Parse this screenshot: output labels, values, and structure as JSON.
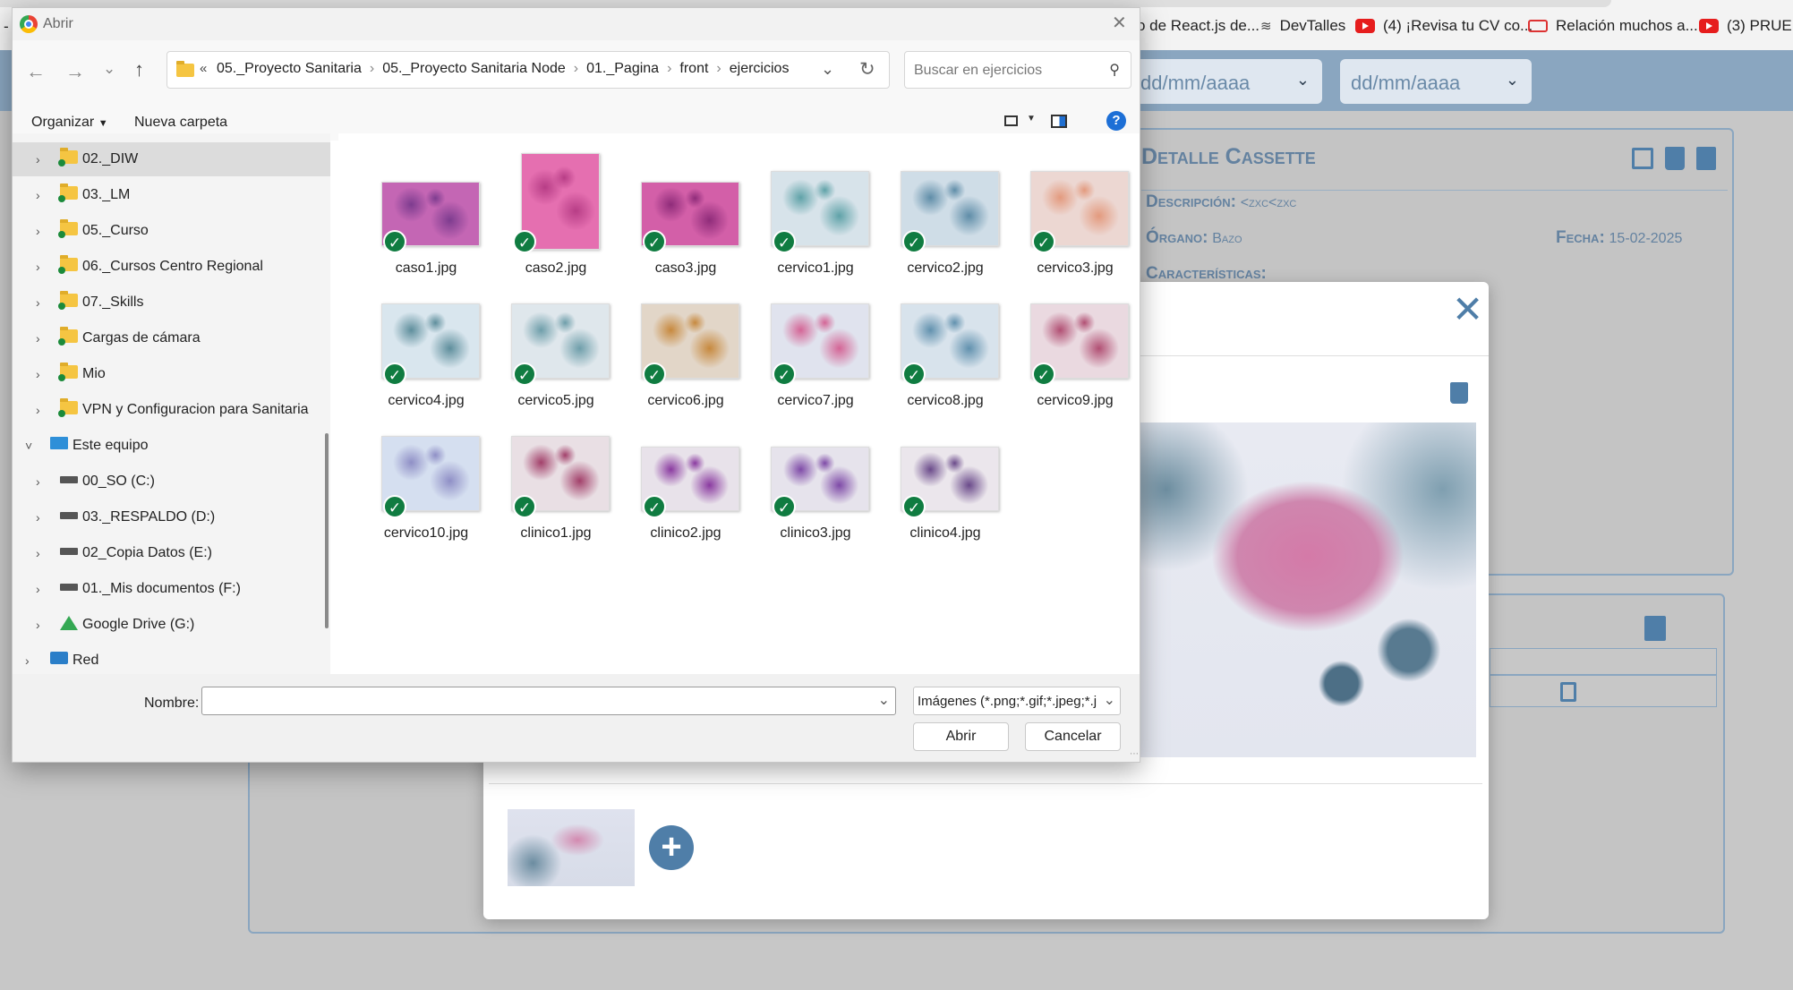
{
  "bookmarks": [
    {
      "label": "o de React.js de...",
      "icon": "react-icon"
    },
    {
      "label": "DevTalles",
      "icon": "devtalles-icon"
    },
    {
      "label": "(4) ¡Revisa tu CV co...",
      "icon": "youtube-icon"
    },
    {
      "label": "Relación muchos a...",
      "icon": "bookmark-icon"
    },
    {
      "label": "(3) PRUEBA",
      "icon": "youtube-icon"
    }
  ],
  "page": {
    "date_from_placeholder": "dd/mm/aaaa",
    "date_to_placeholder": "dd/mm/aaaa",
    "detail_title": "Detalle Cassette",
    "description_label": "Descripción:",
    "description_value": "<zxc<zxc",
    "organ_label": "Órgano:",
    "organ_value": "Bazo",
    "date_label": "Fecha:",
    "date_value": "15-02-2025",
    "features_label": "Características:"
  },
  "dialog": {
    "title": "Abrir",
    "breadcrumb": [
      "05._Proyecto Sanitaria",
      "05._Proyecto Sanitaria Node",
      "01._Pagina",
      "front",
      "ejercicios"
    ],
    "search_placeholder": "Buscar en ejercicios",
    "organize_label": "Organizar",
    "new_folder_label": "Nueva carpeta",
    "tree": [
      {
        "label": "02._DIW",
        "type": "folder",
        "indent": 1,
        "selected": true
      },
      {
        "label": "03._LM",
        "type": "folder",
        "indent": 1
      },
      {
        "label": "05._Curso",
        "type": "folder",
        "indent": 1
      },
      {
        "label": "06._Cursos Centro Regional",
        "type": "folder",
        "indent": 1
      },
      {
        "label": "07._Skills",
        "type": "folder",
        "indent": 1
      },
      {
        "label": "Cargas de cámara",
        "type": "folder",
        "indent": 1
      },
      {
        "label": "Mio",
        "type": "folder",
        "indent": 1
      },
      {
        "label": "VPN y Configuracion para Sanitaria",
        "type": "folder",
        "indent": 1
      },
      {
        "label": "Este equipo",
        "type": "pc",
        "indent": 0,
        "expanded": true
      },
      {
        "label": "00_SO (C:)",
        "type": "drive",
        "indent": 1
      },
      {
        "label": "03._RESPALDO (D:)",
        "type": "drive",
        "indent": 1
      },
      {
        "label": "02_Copia Datos (E:)",
        "type": "drive",
        "indent": 1
      },
      {
        "label": "01._Mis documentos (F:)",
        "type": "drive",
        "indent": 1
      },
      {
        "label": "Google Drive (G:)",
        "type": "gdrive",
        "indent": 1
      },
      {
        "label": "Red",
        "type": "network",
        "indent": 0
      }
    ],
    "files": [
      {
        "name": "caso1.jpg",
        "c1": "#c466b4",
        "c2": "#7d3c8f",
        "shape": "wide"
      },
      {
        "name": "caso2.jpg",
        "c1": "#e56fb0",
        "c2": "#b73d86",
        "shape": "tall"
      },
      {
        "name": "caso3.jpg",
        "c1": "#d35fa8",
        "c2": "#8f2c7a",
        "shape": "wide"
      },
      {
        "name": "cervico1.jpg",
        "c1": "#d7e3ea",
        "c2": "#5fa2a8",
        "shape": "sq"
      },
      {
        "name": "cervico2.jpg",
        "c1": "#cfdde7",
        "c2": "#5f8da8",
        "shape": "sq"
      },
      {
        "name": "cervico3.jpg",
        "c1": "#ecd7d2",
        "c2": "#e39a7e",
        "shape": "sq"
      },
      {
        "name": "cervico4.jpg",
        "c1": "#d9e6ee",
        "c2": "#5e8e9c",
        "shape": "sq"
      },
      {
        "name": "cervico5.jpg",
        "c1": "#dfe7ec",
        "c2": "#6e9eaa",
        "shape": "sq"
      },
      {
        "name": "cervico6.jpg",
        "c1": "#e2d6c8",
        "c2": "#c7893e",
        "shape": "sq"
      },
      {
        "name": "cervico7.jpg",
        "c1": "#e0e3ee",
        "c2": "#d46596",
        "shape": "sq"
      },
      {
        "name": "cervico8.jpg",
        "c1": "#d8e3ec",
        "c2": "#6191ae",
        "shape": "sq"
      },
      {
        "name": "cervico9.jpg",
        "c1": "#ead9e0",
        "c2": "#b14f73",
        "shape": "sq"
      },
      {
        "name": "cervico10.jpg",
        "c1": "#d5dff0",
        "c2": "#8f8fc6",
        "shape": "sq"
      },
      {
        "name": "clinico1.jpg",
        "c1": "#e9dfe4",
        "c2": "#a2406a",
        "shape": "sq"
      },
      {
        "name": "clinico2.jpg",
        "c1": "#e8e2ea",
        "c2": "#8a3aa0",
        "shape": "wide"
      },
      {
        "name": "clinico3.jpg",
        "c1": "#e6e3ec",
        "c2": "#7e4aa7",
        "shape": "wide"
      },
      {
        "name": "clinico4.jpg",
        "c1": "#ebe6ec",
        "c2": "#6a4a8a",
        "shape": "wide"
      }
    ],
    "filename_label": "Nombre:",
    "filename_value": "",
    "filter_value": "Imágenes (*.png;*.gif;*.jpeg;*.jpg",
    "open_button": "Abrir",
    "cancel_button": "Cancelar"
  }
}
